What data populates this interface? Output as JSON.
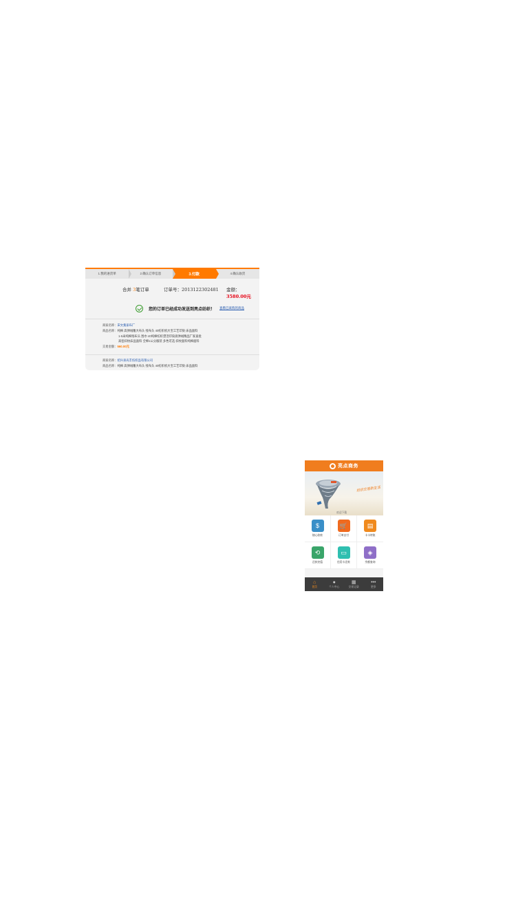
{
  "checkout": {
    "steps": [
      {
        "label": "1.我的进货单",
        "active": false
      },
      {
        "label": "2.确认订单信息",
        "active": false
      },
      {
        "label": "3.付款",
        "active": true
      },
      {
        "label": "4.确认收货",
        "active": false
      }
    ],
    "summary": {
      "merge_prefix": "合并",
      "merge_count": "3",
      "merge_suffix": "笔订单",
      "order_no_label": "订单号：",
      "order_no": "2013122302481",
      "amount_label": "金额：",
      "amount": "3580.00元"
    },
    "success_message": "您的订单已经成功发送到亮点纺织！",
    "view_link": "查看已采购的商品",
    "orders": [
      {
        "seller_label": "商家名称：",
        "seller": "宋文集家布厂",
        "goods_label": "商品名称：",
        "goods_lines": [
          "纯棉 高弹绒雕大布头  残布头  40纺织机大宝工艺印染  床品面料",
          "1-5米纯棉残布头  围巾  40纯棉纺织漂活印染高弹绒精品厂家直批",
          "高密斜纹床品面料  全棉1公分服装  多色可选  斜纹面料纯棉面料"
        ],
        "total_label": "交易金额：",
        "total": "560.00元"
      },
      {
        "seller_label": "商家名称：",
        "seller": "绍兴县光丰纺织品有限公司",
        "goods_label": "商品名称：",
        "goods_lines": [
          "纯棉 高弹绒雕大布头  残布头  40纺织机大宝工艺印染  床品面料"
        ]
      }
    ]
  },
  "app": {
    "title": "亮点商务",
    "banner_slogan": "纺织交易新生活",
    "banner_sub": "欢迎下载",
    "grid": [
      {
        "label": "随心收款",
        "icon": "money-bag-icon",
        "glyph": "$",
        "color": "#3a8fc8"
      },
      {
        "label": "订单支付",
        "icon": "cart-icon",
        "glyph": "🛒",
        "color": "#f06a1e"
      },
      {
        "label": "卡卡转账",
        "icon": "card-icon",
        "glyph": "▤",
        "color": "#f08a1e"
      },
      {
        "label": "还款充值",
        "icon": "repay-icon",
        "glyph": "⟲",
        "color": "#3aa56a"
      },
      {
        "label": "信用卡还款",
        "icon": "credit-card-icon",
        "glyph": "▭",
        "color": "#2fbfb0"
      },
      {
        "label": "余额查询",
        "icon": "wallet-icon",
        "glyph": "◈",
        "color": "#8f6fc8"
      }
    ],
    "tabs": [
      {
        "label": "首页",
        "icon": "home-icon",
        "glyph": "⌂",
        "active": true
      },
      {
        "label": "个人中心",
        "icon": "user-icon",
        "glyph": "●",
        "active": false
      },
      {
        "label": "交易记录",
        "icon": "record-icon",
        "glyph": "▦",
        "active": false
      },
      {
        "label": "更多",
        "icon": "more-icon",
        "glyph": "•••",
        "active": false
      }
    ]
  }
}
